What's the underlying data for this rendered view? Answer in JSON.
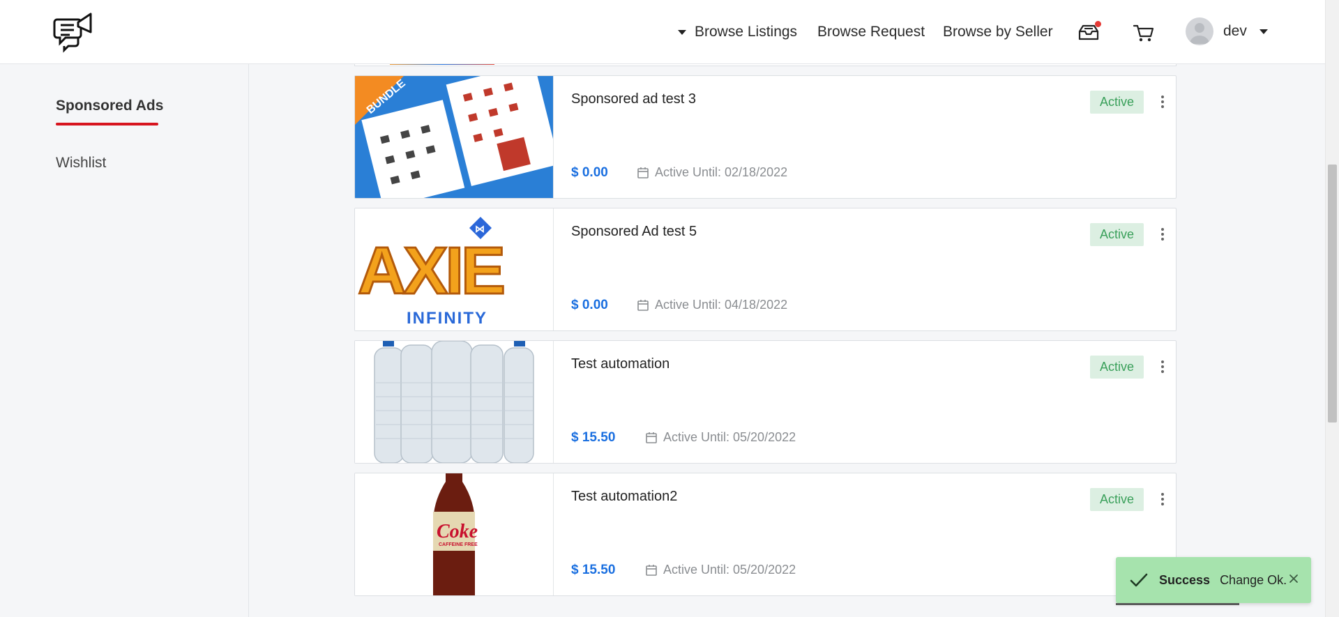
{
  "header": {
    "nav": {
      "browse_listings": "Browse Listings",
      "browse_request": "Browse Request",
      "browse_by_seller": "Browse by Seller"
    },
    "user": {
      "name": "dev"
    }
  },
  "sidebar": {
    "items": [
      {
        "label": "Sponsored Ads",
        "active": true
      },
      {
        "label": "Wishlist",
        "active": false
      }
    ]
  },
  "listings": [
    {
      "title": "Sponsored ad test 3",
      "price": "$ 0.00",
      "active_until": "Active Until: 02/18/2022",
      "status": "Active",
      "image": "product-bundle-image"
    },
    {
      "title": "Sponsored Ad test 5",
      "price": "$ 0.00",
      "active_until": "Active Until: 04/18/2022",
      "status": "Active",
      "image": "axie-infinity-logo-image"
    },
    {
      "title": "Test automation",
      "price": "$ 15.50",
      "active_until": "Active Until: 05/20/2022",
      "status": "Active",
      "image": "water-bottles-image"
    },
    {
      "title": "Test automation2",
      "price": "$ 15.50",
      "active_until": "Active Until: 05/20/2022",
      "status": "Active",
      "image": "diet-coke-bottle-image"
    }
  ],
  "colors": {
    "accent_red": "#d7141e",
    "price_blue": "#1a6fe0",
    "badge_bg": "#dcefe2",
    "badge_text": "#3aa05a",
    "toast_bg": "#a6e3ad"
  },
  "toast": {
    "title": "Success",
    "message": "Change Ok."
  }
}
